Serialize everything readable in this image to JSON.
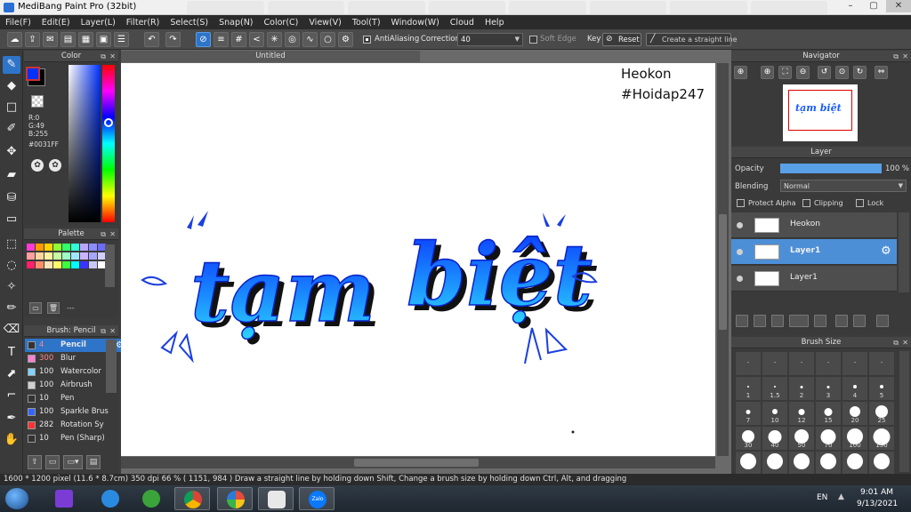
{
  "window": {
    "title": "MediBang Paint Pro (32bit)",
    "min": "–",
    "max": "▢",
    "close": "✕"
  },
  "menu": [
    "File(F)",
    "Edit(E)",
    "Layer(L)",
    "Filter(R)",
    "Select(S)",
    "Snap(N)",
    "Color(C)",
    "View(V)",
    "Tool(T)",
    "Window(W)",
    "Cloud",
    "Help"
  ],
  "toolbar": {
    "antialiasing": "AntiAliasing",
    "correction_label": "Correction",
    "correction_value": "40",
    "soft_edge": "Soft Edge",
    "key_label": "Key",
    "reset": "Reset",
    "straight_line": "Create a straight line"
  },
  "color_panel": {
    "title": "Color",
    "fg_color": "#0031FF",
    "r": "R:0",
    "g": "G:49",
    "b": "B:255",
    "hex": "#0031FF"
  },
  "palette": {
    "title": "Palette",
    "colors": [
      "#ff3bd5",
      "#ff9900",
      "#ffd200",
      "#8fff33",
      "#33ff66",
      "#33ffd5",
      "#bba6ff",
      "#8c8cff",
      "#6a6aff",
      "#ff9f9f",
      "#ffd49f",
      "#fff39f",
      "#c5ff9f",
      "#9fffc6",
      "#9fe8ff",
      "#cbb3ff",
      "#a6a6ff",
      "#d0d0ff",
      "#ff1f6b",
      "#ff8f6b",
      "#ffe5b8",
      "#ffff66",
      "#3aff3a",
      "#00ffff",
      "#3d33ff",
      "#c7c7ff",
      "#ffffff"
    ],
    "empty_label": "---"
  },
  "brush": {
    "title": "Brush: Pencil",
    "items": [
      {
        "size": "4",
        "name": "Pencil",
        "color": "#333333"
      },
      {
        "size": "300",
        "name": "Blur",
        "color": "#ff7fd4"
      },
      {
        "size": "100",
        "name": "Watercolor",
        "color": "#7fd4ff"
      },
      {
        "size": "100",
        "name": "Airbrush",
        "color": "#d0d0d0"
      },
      {
        "size": "10",
        "name": "Pen",
        "color": "#333333"
      },
      {
        "size": "100",
        "name": "Sparkle Brus",
        "color": "#3366ff"
      },
      {
        "size": "282",
        "name": "Rotation Sy",
        "color": "#ff3333"
      },
      {
        "size": "10",
        "name": "Pen (Sharp)",
        "color": "#333333"
      }
    ]
  },
  "document": {
    "tab": "Untitled",
    "canvas_text_1": "Heokon",
    "canvas_text_2": "#Hoidap247",
    "artwork_word_1": "tạm",
    "artwork_word_2": "biệt"
  },
  "navigator": {
    "title": "Navigator"
  },
  "layer": {
    "title": "Layer",
    "opacity_label": "Opacity",
    "opacity_value": "100 %",
    "opacity_fraction": 1.0,
    "blending_label": "Blending",
    "blending_value": "Normal",
    "protect_alpha": "Protect Alpha",
    "clipping": "Clipping",
    "lock": "Lock",
    "layers": [
      {
        "name": "Heokon",
        "selected": false
      },
      {
        "name": "Layer1",
        "selected": true
      },
      {
        "name": "Layer1",
        "selected": false
      }
    ]
  },
  "brush_size": {
    "title": "Brush Size",
    "sizes": [
      "",
      "",
      "",
      "",
      "",
      "",
      "1",
      "1.5",
      "2",
      "3",
      "4",
      "5",
      "7",
      "10",
      "12",
      "15",
      "20",
      "25",
      "30",
      "40",
      "50",
      "70",
      "100",
      "150",
      "",
      "",
      "",
      "",
      "",
      ""
    ]
  },
  "status": {
    "text": "1600 * 1200 pixel  (11.6 * 8.7cm)  350 dpi  66 %   ( 1151, 984 )  Draw a straight line by holding down Shift, Change a brush size by holding down Ctrl, Alt, and dragging"
  },
  "taskbar": {
    "lang": "EN",
    "time": "9:01 AM",
    "date": "9/13/2021",
    "zalo": "Zalo"
  },
  "colors": {
    "accent": "#2e74c9",
    "brand_blue": "#0031FF"
  }
}
